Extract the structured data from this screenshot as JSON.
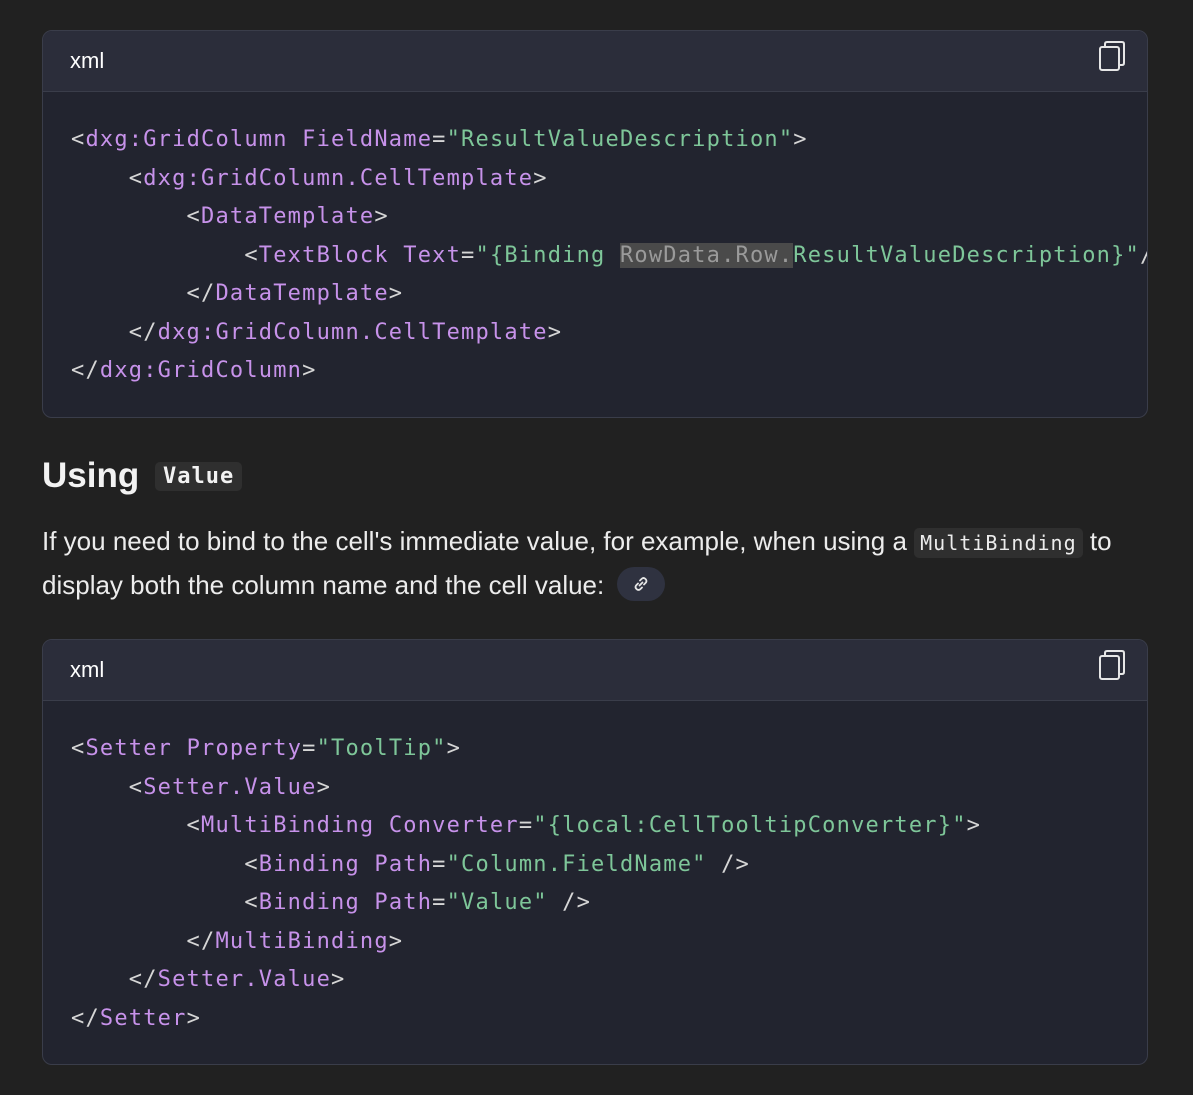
{
  "code_block_1": {
    "language": "xml",
    "copy_icon": "copy-icon",
    "lines": [
      [
        [
          "p",
          "<"
        ],
        [
          "t",
          "dxg:GridColumn"
        ],
        [
          "p",
          " "
        ],
        [
          "a",
          "FieldName"
        ],
        [
          "p",
          "="
        ],
        [
          "s",
          "\"ResultValueDescription\""
        ],
        [
          "p",
          ">"
        ]
      ],
      [
        [
          "p",
          "    <"
        ],
        [
          "t",
          "dxg:GridColumn.CellTemplate"
        ],
        [
          "p",
          ">"
        ]
      ],
      [
        [
          "p",
          "        <"
        ],
        [
          "t",
          "DataTemplate"
        ],
        [
          "p",
          ">"
        ]
      ],
      [
        [
          "p",
          "            <"
        ],
        [
          "t",
          "TextBlock"
        ],
        [
          "p",
          " "
        ],
        [
          "a",
          "Text"
        ],
        [
          "p",
          "="
        ],
        [
          "s",
          "\"{Binding "
        ],
        [
          "hl",
          "RowData.Row."
        ],
        [
          "s",
          "ResultValueDescription}\""
        ],
        [
          "p",
          "/>"
        ]
      ],
      [
        [
          "p",
          "        </"
        ],
        [
          "t",
          "DataTemplate"
        ],
        [
          "p",
          ">"
        ]
      ],
      [
        [
          "p",
          "    </"
        ],
        [
          "t",
          "dxg:GridColumn.CellTemplate"
        ],
        [
          "p",
          ">"
        ]
      ],
      [
        [
          "p",
          "</"
        ],
        [
          "t",
          "dxg:GridColumn"
        ],
        [
          "p",
          ">"
        ]
      ]
    ]
  },
  "section": {
    "heading_text": "Using",
    "heading_code": "Value",
    "paragraph_before": "If you need to bind to the cell's immediate value, for example, when using a ",
    "paragraph_code": "MultiBinding",
    "paragraph_after": " to display both the column name and the cell value:",
    "link_icon": "link-icon"
  },
  "code_block_2": {
    "language": "xml",
    "copy_icon": "copy-icon",
    "lines": [
      [
        [
          "p",
          "<"
        ],
        [
          "t",
          "Setter"
        ],
        [
          "p",
          " "
        ],
        [
          "a",
          "Property"
        ],
        [
          "p",
          "="
        ],
        [
          "s",
          "\"ToolTip\""
        ],
        [
          "p",
          ">"
        ]
      ],
      [
        [
          "p",
          "    <"
        ],
        [
          "t",
          "Setter.Value"
        ],
        [
          "p",
          ">"
        ]
      ],
      [
        [
          "p",
          "        <"
        ],
        [
          "t",
          "MultiBinding"
        ],
        [
          "p",
          " "
        ],
        [
          "a",
          "Converter"
        ],
        [
          "p",
          "="
        ],
        [
          "s",
          "\"{local:CellTooltipConverter}\""
        ],
        [
          "p",
          ">"
        ]
      ],
      [
        [
          "p",
          "            <"
        ],
        [
          "t",
          "Binding"
        ],
        [
          "p",
          " "
        ],
        [
          "a",
          "Path"
        ],
        [
          "p",
          "="
        ],
        [
          "s",
          "\"Column.FieldName\""
        ],
        [
          "p",
          " />"
        ]
      ],
      [
        [
          "p",
          "            <"
        ],
        [
          "t",
          "Binding"
        ],
        [
          "p",
          " "
        ],
        [
          "a",
          "Path"
        ],
        [
          "p",
          "="
        ],
        [
          "s",
          "\"Value\""
        ],
        [
          "p",
          " />"
        ]
      ],
      [
        [
          "p",
          "        </"
        ],
        [
          "t",
          "MultiBinding"
        ],
        [
          "p",
          ">"
        ]
      ],
      [
        [
          "p",
          "    </"
        ],
        [
          "t",
          "Setter.Value"
        ],
        [
          "p",
          ">"
        ]
      ],
      [
        [
          "p",
          "</"
        ],
        [
          "t",
          "Setter"
        ],
        [
          "p",
          ">"
        ]
      ]
    ]
  }
}
